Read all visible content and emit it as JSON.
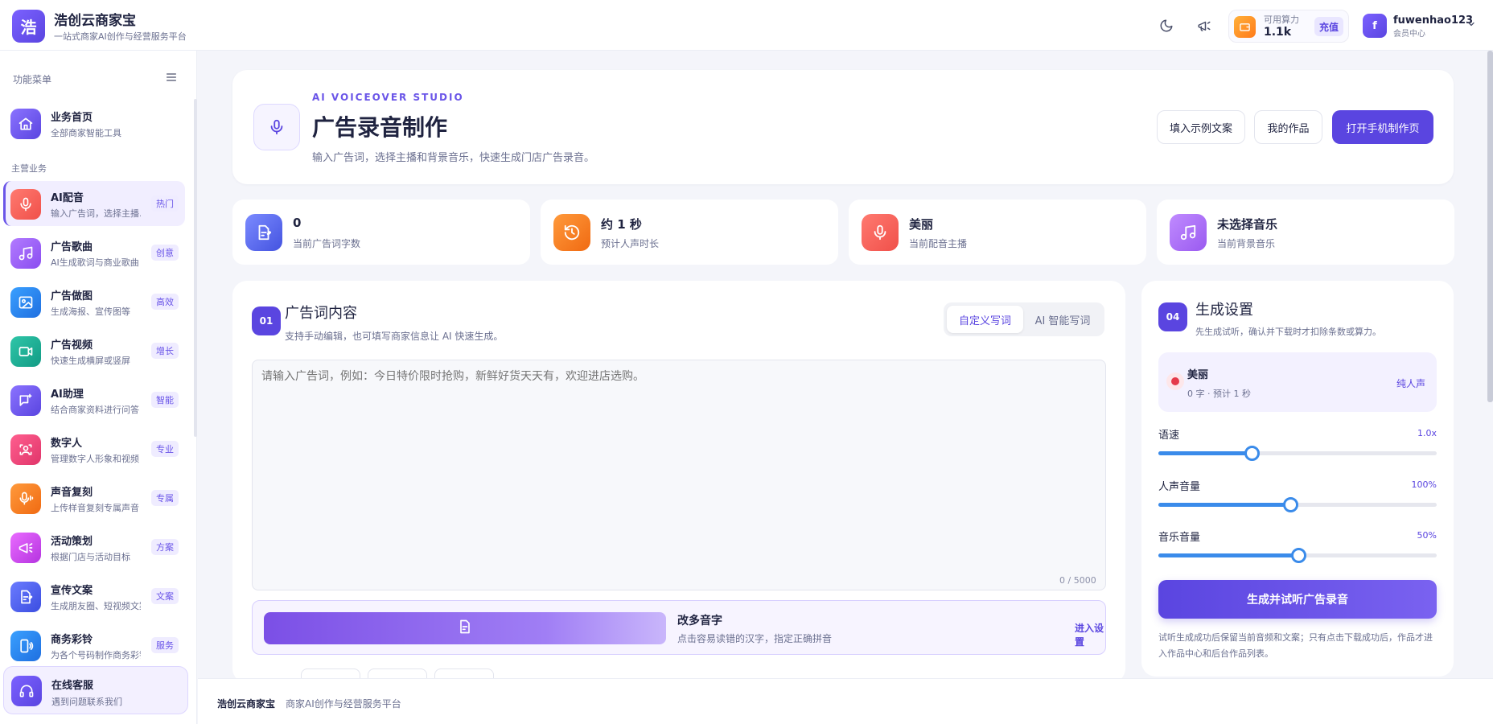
{
  "header": {
    "logo_char": "浩",
    "brand_name": "浩创云商家宝",
    "brand_sub": "一站式商家AI创作与经营服务平台",
    "credit_label": "可用算力",
    "credit_value": "1.1k",
    "recharge_label": "充值",
    "avatar_char": "f",
    "username": "fuwenhao123",
    "user_role": "会员中心"
  },
  "sidebar": {
    "menu_title": "功能菜单",
    "section_label": "主营业务",
    "home": {
      "label": "业务首页",
      "desc": "全部商家智能工具"
    },
    "items": [
      {
        "label": "AI配音",
        "desc": "输入广告词，选择主播…",
        "badge": "热门"
      },
      {
        "label": "广告歌曲",
        "desc": "AI生成歌词与商业歌曲",
        "badge": "创意"
      },
      {
        "label": "广告做图",
        "desc": "生成海报、宣传图等",
        "badge": "高效"
      },
      {
        "label": "广告视频",
        "desc": "快速生成横屏或竖屏",
        "badge": "增长"
      },
      {
        "label": "AI助理",
        "desc": "结合商家资料进行问答",
        "badge": "智能"
      },
      {
        "label": "数字人",
        "desc": "管理数字人形象和视频",
        "badge": "专业"
      },
      {
        "label": "声音复刻",
        "desc": "上传样音复刻专属声音",
        "badge": "专属"
      },
      {
        "label": "活动策划",
        "desc": "根据门店与活动目标",
        "badge": "方案"
      },
      {
        "label": "宣传文案",
        "desc": "生成朋友圈、短视频文案",
        "badge": "文案"
      },
      {
        "label": "商务彩铃",
        "desc": "为各个号码制作商务彩铃",
        "badge": "服务"
      }
    ],
    "service": {
      "label": "在线客服",
      "desc": "遇到问题联系我们"
    }
  },
  "hero": {
    "kicker": "AI VOICEOVER STUDIO",
    "title": "广告录音制作",
    "subtitle": "输入广告词，选择主播和背景音乐，快速生成门店广告录音。",
    "btn_example": "填入示例文案",
    "btn_works": "我的作品",
    "btn_mobile": "打开手机制作页"
  },
  "stats": [
    {
      "value": "0",
      "label": "当前广告词字数"
    },
    {
      "value": "约 1 秒",
      "label": "预计人声时长"
    },
    {
      "value": "美丽",
      "label": "当前配音主播"
    },
    {
      "value": "未选择音乐",
      "label": "当前背景音乐"
    }
  ],
  "content": {
    "step": "01",
    "title": "广告词内容",
    "subtitle": "支持手动编辑，也可填写商家信息让 AI 快速生成。",
    "tab_custom": "自定义写词",
    "tab_ai": "AI 智能写词",
    "placeholder": "请输入广告词，例如：今日特价限时抢购，新鲜好货天天有，欢迎进店选购。",
    "counter": "0 / 5000",
    "pinyin_title": "改多音字",
    "pinyin_desc": "点击容易读错的汉字，指定正确拼音",
    "pinyin_link": "进入设置"
  },
  "settings": {
    "step": "04",
    "title": "生成设置",
    "subtitle": "先生成试听，确认并下载时才扣除条数或算力。",
    "voice_name": "美丽",
    "voice_meta": "0 字 · 预计 1 秒",
    "voice_tag": "纯人声",
    "speed_label": "语速",
    "speed_value": "1.0x",
    "speed_level": 0.335,
    "vocal_label": "人声音量",
    "vocal_value": "100%",
    "vocal_level": 0.475,
    "music_label": "音乐音量",
    "music_value": "50%",
    "music_level": 0.502,
    "generate_button": "生成并试听广告录音",
    "note": "试听生成成功后保留当前音频和文案；只有点击下载成功后，作品才进入作品中心和后台作品列表。"
  },
  "footer": {
    "brand": "浩创云商家宝",
    "desc": "商家AI创作与经营服务平台"
  },
  "colors": {
    "accent": "#5a45e0",
    "slider": "#3a8bea"
  }
}
